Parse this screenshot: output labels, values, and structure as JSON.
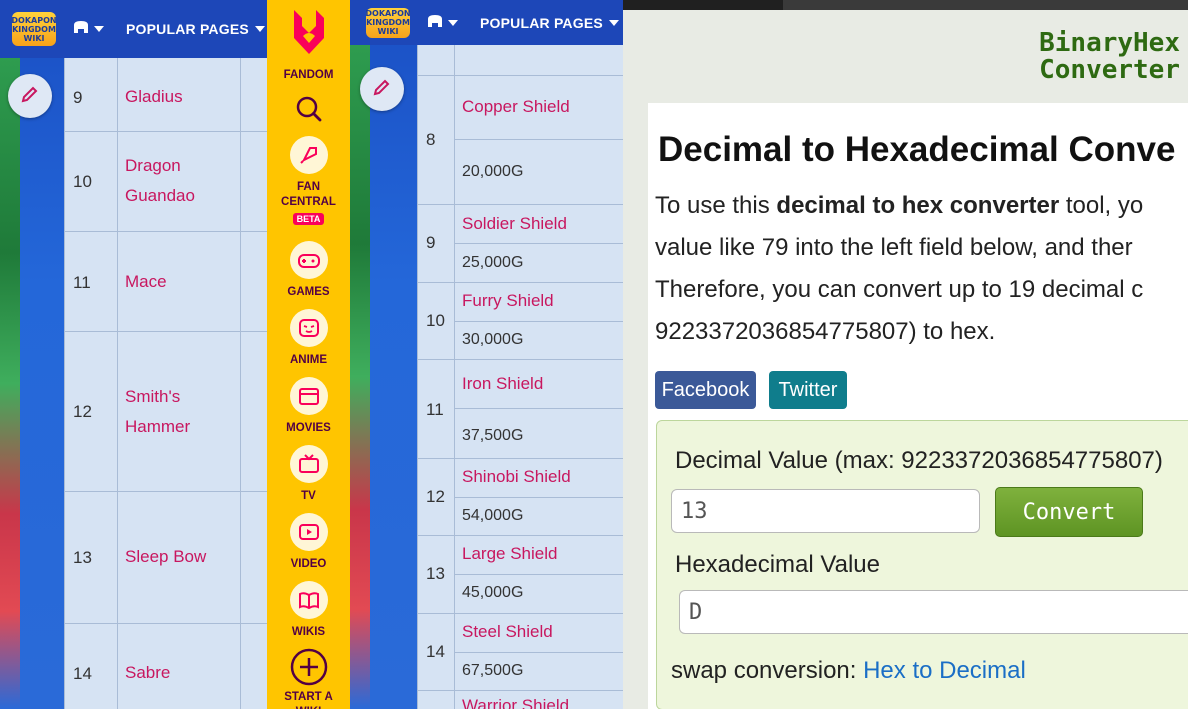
{
  "wiki": {
    "logo_text": "DOKAPON KINGDOM WIKI",
    "popular_pages": "POPULAR PAGES"
  },
  "left_table": {
    "rows": [
      {
        "num": "9",
        "name": "Gladius"
      },
      {
        "num": "10",
        "name": "Dragon Guandao"
      },
      {
        "num": "11",
        "name": "Mace"
      },
      {
        "num": "12",
        "name": "Smith's Hammer"
      },
      {
        "num": "13",
        "name": "Sleep Bow"
      },
      {
        "num": "14",
        "name": "Sabre"
      }
    ]
  },
  "fandom_rail": {
    "brand": "FANDOM",
    "items": [
      {
        "label": "FAN CENTRAL",
        "badge": "BETA",
        "icon": "rocket-icon"
      },
      {
        "label": "GAMES",
        "icon": "gamepad-icon"
      },
      {
        "label": "ANIME",
        "icon": "anime-face-icon"
      },
      {
        "label": "MOVIES",
        "icon": "clapperboard-icon"
      },
      {
        "label": "TV",
        "icon": "tv-icon"
      },
      {
        "label": "VIDEO",
        "icon": "play-icon"
      },
      {
        "label": "WIKIS",
        "icon": "book-icon"
      },
      {
        "label": "START A WIKI",
        "icon": "plus-circle-icon"
      }
    ],
    "accent": "#ffc500"
  },
  "right_table": {
    "rows": [
      {
        "num": "8",
        "name": "Copper Shield",
        "price": "20,000G"
      },
      {
        "num": "9",
        "name": "Soldier Shield",
        "price": "25,000G"
      },
      {
        "num": "10",
        "name": "Furry Shield",
        "price": "30,000G"
      },
      {
        "num": "11",
        "name": "Iron Shield",
        "price": "37,500G"
      },
      {
        "num": "12",
        "name": "Shinobi Shield",
        "price": "54,000G"
      },
      {
        "num": "13",
        "name": "Large Shield",
        "price": "45,000G"
      },
      {
        "num": "14",
        "name": "Steel Shield",
        "price": "67,500G"
      },
      {
        "num": "",
        "name": "Warrior Shield",
        "price": ""
      }
    ]
  },
  "converter": {
    "brand_line1": "BinaryHex",
    "brand_line2": "Converter",
    "title": "Decimal to Hexadecimal Conve",
    "para_line1_a": "To use this ",
    "para_line1_b": "decimal to hex converter",
    "para_line1_c": " tool, yo",
    "para_line2": "value like 79 into the left field below, and ther",
    "para_line3": "Therefore, you can convert up to 19 decimal c",
    "para_line4": "9223372036854775807) to hex.",
    "facebook": "Facebook",
    "twitter": "Twitter",
    "decimal_label": "Decimal Value (max: 9223372036854775807)",
    "decimal_value": "13",
    "convert_button": "Convert",
    "hex_label": "Hexadecimal Value",
    "hex_value": "D",
    "swap_prefix": "swap conversion: ",
    "swap_link": "Hex to Decimal",
    "colors": {
      "facebook": "#3b5998",
      "twitter": "#0f7d8c",
      "convert": "#6ea22f",
      "brand": "#2e6a12"
    }
  }
}
